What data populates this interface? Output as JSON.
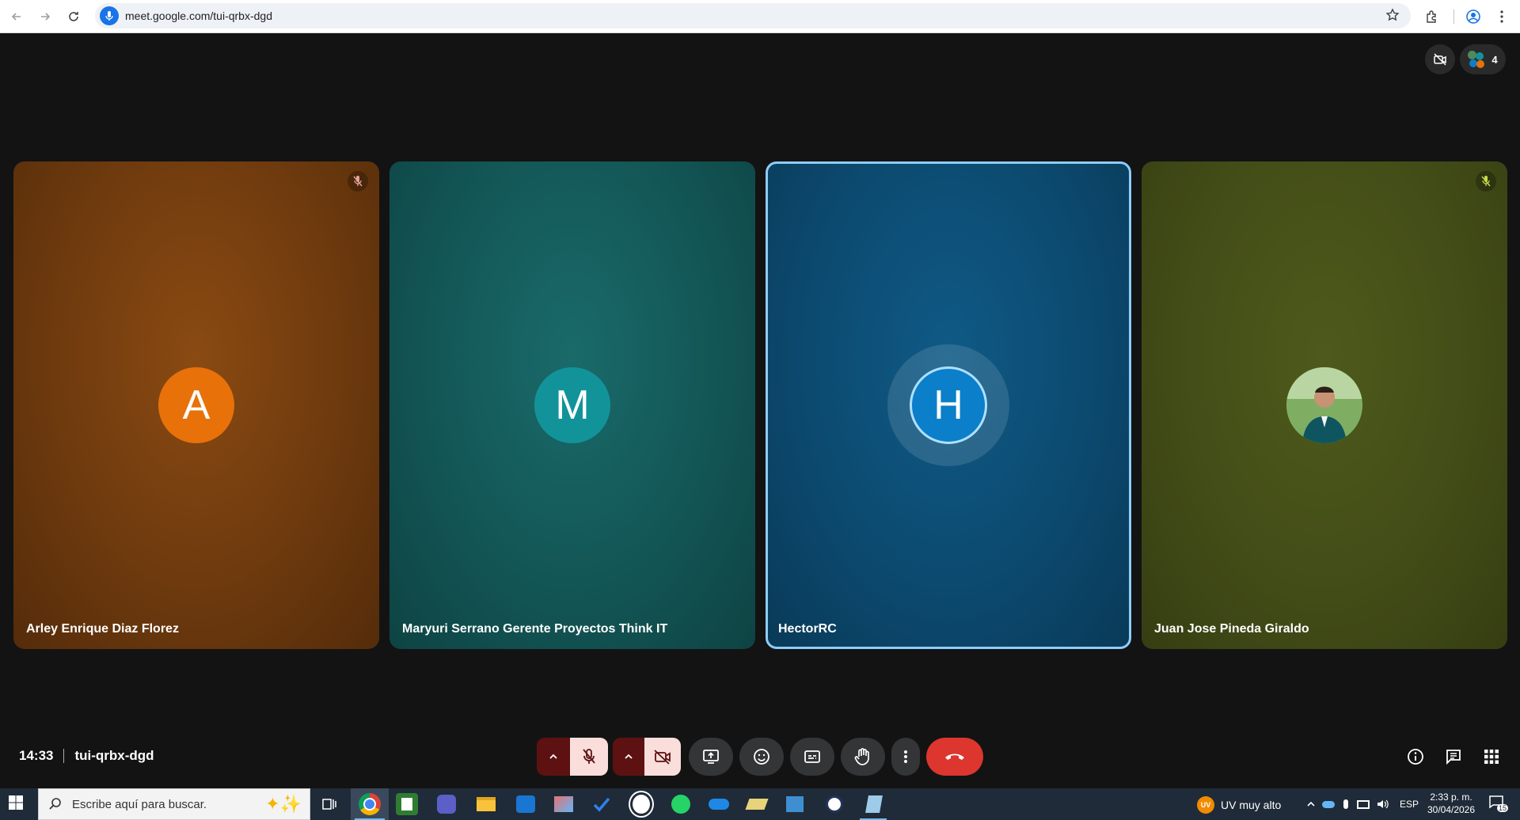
{
  "browser": {
    "url": "meet.google.com/tui-qrbx-dgd"
  },
  "header": {
    "participant_count": "4"
  },
  "participants": [
    {
      "initial": "A",
      "name": "Arley Enrique Diaz Florez",
      "muted": true,
      "color": "#e8710a"
    },
    {
      "initial": "M",
      "name": "Maryuri Serrano Gerente Proyectos Think IT",
      "muted": false,
      "color": "#12939a"
    },
    {
      "initial": "H",
      "name": "HectorRC",
      "muted": false,
      "color": "#0b7fc9"
    },
    {
      "initial": "",
      "name": "Juan Jose Pineda Giraldo",
      "muted": true,
      "photo": true
    }
  ],
  "meeting": {
    "time": "14:33",
    "code": "tui-qrbx-dgd"
  },
  "taskbar": {
    "search_placeholder": "Escribe aquí para buscar.",
    "weather_badge": "UV",
    "weather": "UV muy alto",
    "language": "ESP",
    "clock_time": "2:33 p. m.",
    "clock_date": "30/04/2026",
    "notification_count": "15"
  }
}
